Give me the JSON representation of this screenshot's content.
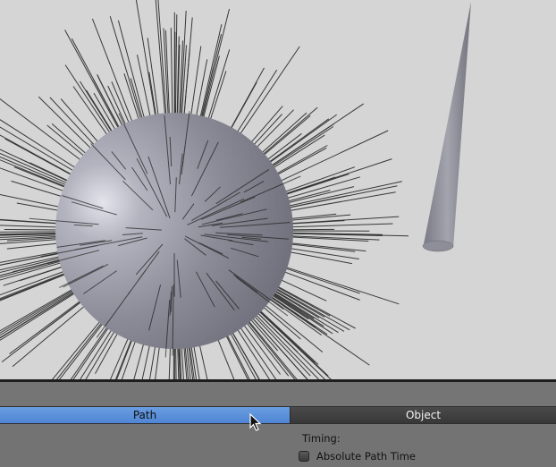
{
  "viewport": {
    "objects": [
      "sphere-with-hair-particles",
      "cone"
    ]
  },
  "tabs": [
    {
      "label": "Path",
      "active": true
    },
    {
      "label": "Object",
      "active": false
    }
  ],
  "panel": {
    "timing_label": "Timing:",
    "absolute_path_time": {
      "label": "Absolute Path Time",
      "checked": false
    }
  },
  "colors": {
    "active_tab": "#5a8fd8",
    "inactive_tab": "#404040",
    "panel_bg": "#737373",
    "viewport_bg": "#d5d5d5"
  }
}
